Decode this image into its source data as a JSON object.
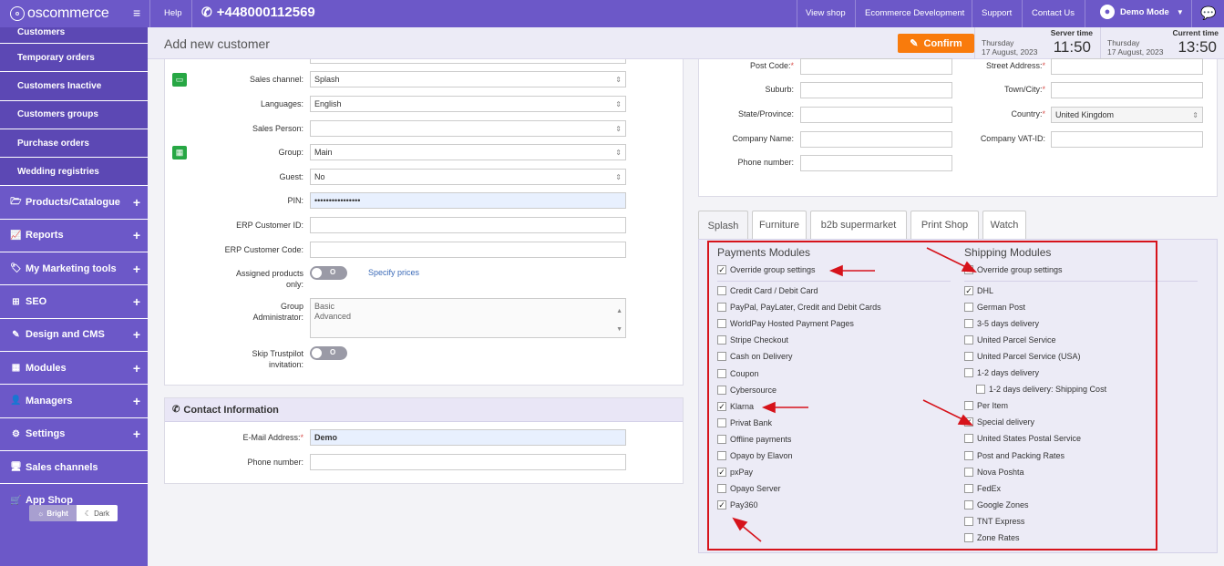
{
  "topbar": {
    "logo": "oscommerce",
    "help": "Help",
    "phone": "+448000112569",
    "links": [
      "View shop",
      "Ecommerce Development",
      "Support",
      "Contact Us"
    ],
    "user": "Demo Mode"
  },
  "sidebar": {
    "sub_items": [
      "Customers",
      "Temporary orders",
      "Customers Inactive",
      "Customers groups",
      "Purchase orders",
      "Wedding registries"
    ],
    "main_items": [
      {
        "label": "Products/Catalogue",
        "icon": "folder-icon",
        "plus": "+"
      },
      {
        "label": "Reports",
        "icon": "chart-icon",
        "plus": "+"
      },
      {
        "label": "My Marketing tools",
        "icon": "tag-icon",
        "plus": "+"
      },
      {
        "label": "SEO",
        "icon": "sitemap-icon",
        "plus": "+"
      },
      {
        "label": "Design and CMS",
        "icon": "brush-icon",
        "plus": "+"
      },
      {
        "label": "Modules",
        "icon": "modules-icon",
        "plus": "+"
      },
      {
        "label": "Managers",
        "icon": "user-icon",
        "plus": "+"
      },
      {
        "label": "Settings",
        "icon": "gears-icon",
        "plus": "+"
      },
      {
        "label": "Sales channels",
        "icon": "desktop-icon",
        "plus": ""
      },
      {
        "label": "App Shop",
        "icon": "cart-icon",
        "plus": ""
      }
    ],
    "theme": {
      "bright": "Bright",
      "dark": "Dark"
    }
  },
  "header": {
    "title": "Add new customer",
    "confirm": "Confirm",
    "server_time": {
      "label": "Server time",
      "day": "Thursday",
      "date": "17 August, 2023",
      "time": "11:50"
    },
    "current_time": {
      "label": "Current time",
      "day": "Thursday",
      "date": "17 August, 2023",
      "time": "13:50"
    }
  },
  "customer_form": {
    "sales_channel": {
      "label": "Sales channel:",
      "value": "Splash"
    },
    "languages": {
      "label": "Languages:",
      "value": "English"
    },
    "sales_person": {
      "label": "Sales Person:",
      "value": ""
    },
    "group": {
      "label": "Group:",
      "value": "Main"
    },
    "guest": {
      "label": "Guest:",
      "value": "No"
    },
    "pin": {
      "label": "PIN:",
      "value": "••••••••••••••••"
    },
    "erp_id": {
      "label": "ERP Customer ID:",
      "value": ""
    },
    "erp_code": {
      "label": "ERP Customer Code:",
      "value": ""
    },
    "assigned_products": {
      "label_1": "Assigned products",
      "label_2": "only:",
      "toggle": "O",
      "link": "Specify prices"
    },
    "group_admin": {
      "label_1": "Group",
      "label_2": "Administrator:",
      "options": [
        "Basic",
        "Advanced"
      ]
    },
    "skip_trustpilot": {
      "label_1": "Skip Trustpilot",
      "label_2": "invitation:",
      "toggle": "O"
    }
  },
  "contact": {
    "heading": "Contact Information",
    "email": {
      "label": "E-Mail Address:",
      "required": "*",
      "value": "Demo"
    },
    "phone": {
      "label": "Phone number:",
      "value": ""
    }
  },
  "address": {
    "post_code": {
      "label": "Post Code:",
      "required": "*",
      "value": ""
    },
    "street": {
      "label": "Street Address:",
      "required": "*",
      "value": ""
    },
    "suburb": {
      "label": "Suburb:",
      "value": ""
    },
    "town": {
      "label": "Town/City:",
      "required": "*",
      "value": ""
    },
    "state": {
      "label": "State/Province:",
      "value": ""
    },
    "country": {
      "label": "Country:",
      "required": "*",
      "value": "United Kingdom"
    },
    "company": {
      "label": "Company Name:",
      "value": ""
    },
    "vat": {
      "label": "Company VAT-ID:",
      "value": ""
    },
    "phone": {
      "label": "Phone number:",
      "value": ""
    }
  },
  "tabs": [
    "Splash",
    "Furniture",
    "b2b supermarket",
    "Print Shop",
    "Watch"
  ],
  "payments": {
    "title": "Payments Modules",
    "override": {
      "label": "Override group settings",
      "checked": true
    },
    "items": [
      {
        "label": "Credit Card / Debit Card",
        "checked": false
      },
      {
        "label": "PayPal, PayLater, Credit and Debit Cards",
        "checked": false
      },
      {
        "label": "WorldPay Hosted Payment Pages",
        "checked": false
      },
      {
        "label": "Stripe Checkout",
        "checked": false
      },
      {
        "label": "Cash on Delivery",
        "checked": false
      },
      {
        "label": "Coupon",
        "checked": false
      },
      {
        "label": "Cybersource",
        "checked": false
      },
      {
        "label": "Klarna",
        "checked": true
      },
      {
        "label": "Privat Bank",
        "checked": false
      },
      {
        "label": "Offline payments",
        "checked": false
      },
      {
        "label": "Opayo by Elavon",
        "checked": false
      },
      {
        "label": "pxPay",
        "checked": true
      },
      {
        "label": "Opayo Server",
        "checked": false
      },
      {
        "label": "Pay360",
        "checked": true
      }
    ]
  },
  "shipping": {
    "title": "Shipping Modules",
    "override": {
      "label": "Override group settings",
      "checked": true
    },
    "items": [
      {
        "label": "DHL",
        "checked": true
      },
      {
        "label": "German Post",
        "checked": false
      },
      {
        "label": "3-5 days delivery",
        "checked": false
      },
      {
        "label": "United Parcel Service",
        "checked": false
      },
      {
        "label": "United Parcel Service (USA)",
        "checked": false
      },
      {
        "label": "1-2 days delivery",
        "checked": false
      },
      {
        "label": "1-2 days delivery: Shipping Cost",
        "checked": false,
        "indent": true
      },
      {
        "label": "Per Item",
        "checked": false
      },
      {
        "label": "Special delivery",
        "checked": true
      },
      {
        "label": "United States Postal Service",
        "checked": false
      },
      {
        "label": "Post and Packing Rates",
        "checked": false
      },
      {
        "label": "Nova Poshta",
        "checked": false
      },
      {
        "label": "FedEx",
        "checked": false
      },
      {
        "label": "Google Zones",
        "checked": false
      },
      {
        "label": "TNT Express",
        "checked": false
      },
      {
        "label": "Zone Rates",
        "checked": false
      }
    ]
  },
  "colors": {
    "brand": "#6c58c8",
    "confirm": "#f97b0c",
    "annotation": "#d6131b"
  }
}
